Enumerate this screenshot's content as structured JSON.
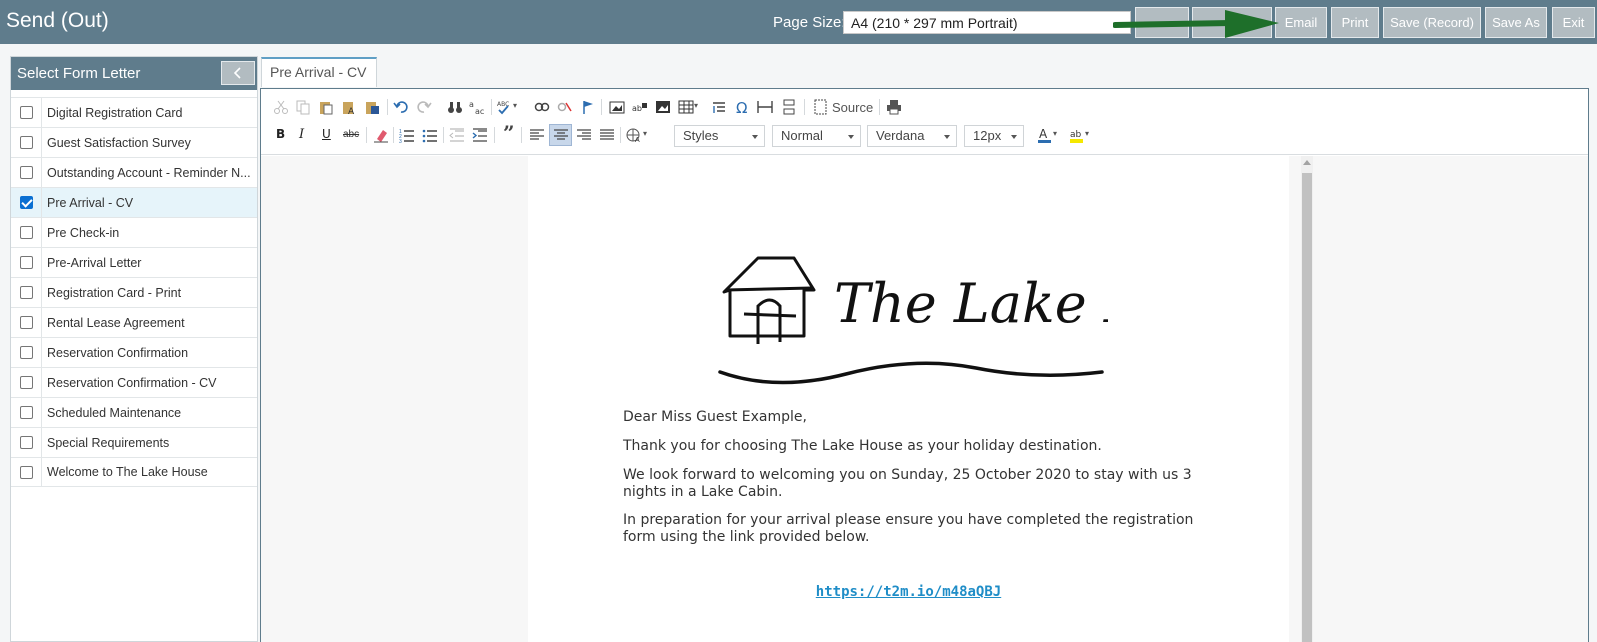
{
  "header": {
    "title": "Send (Out)",
    "page_size_label": "Page Size:",
    "page_size_value": "A4 (210 * 297 mm Portrait)",
    "buttons": [
      "Email",
      "Print",
      "Save (Record)",
      "Save As",
      "Exit"
    ],
    "arrow_color": "#1e6f2a"
  },
  "sidebar": {
    "title": "Select Form Letter",
    "items": [
      {
        "label": "Digital Registration Card",
        "checked": false
      },
      {
        "label": "Guest Satisfaction Survey",
        "checked": false
      },
      {
        "label": "Outstanding Account - Reminder N...",
        "checked": false
      },
      {
        "label": "Pre Arrival - CV",
        "checked": true
      },
      {
        "label": "Pre Check-in",
        "checked": false
      },
      {
        "label": "Pre-Arrival Letter",
        "checked": false
      },
      {
        "label": "Registration Card - Print",
        "checked": false
      },
      {
        "label": "Rental Lease Agreement",
        "checked": false
      },
      {
        "label": "Reservation Confirmation",
        "checked": false
      },
      {
        "label": "Reservation Confirmation - CV",
        "checked": false
      },
      {
        "label": "Scheduled Maintenance",
        "checked": false
      },
      {
        "label": "Special Requirements",
        "checked": false
      },
      {
        "label": "Welcome to The Lake House",
        "checked": false
      }
    ]
  },
  "editor": {
    "tab_label": "Pre Arrival - CV",
    "toolbar": {
      "source_label": "Source",
      "styles": "Styles",
      "format": "Normal",
      "font": "Verdana",
      "size": "12px"
    },
    "letter": {
      "logo_text": "The Lake House.",
      "greeting": "Dear Miss Guest Example,",
      "p1": "Thank you for choosing The Lake House as your holiday destination.",
      "p2": "We look forward to welcoming you on Sunday, 25 October 2020 to stay with us 3 nights in a Lake Cabin.",
      "p3": "In preparation for your arrival please ensure you have completed the registration form using the link provided below.",
      "link": "https://t2m.io/m48aQBJ"
    }
  }
}
